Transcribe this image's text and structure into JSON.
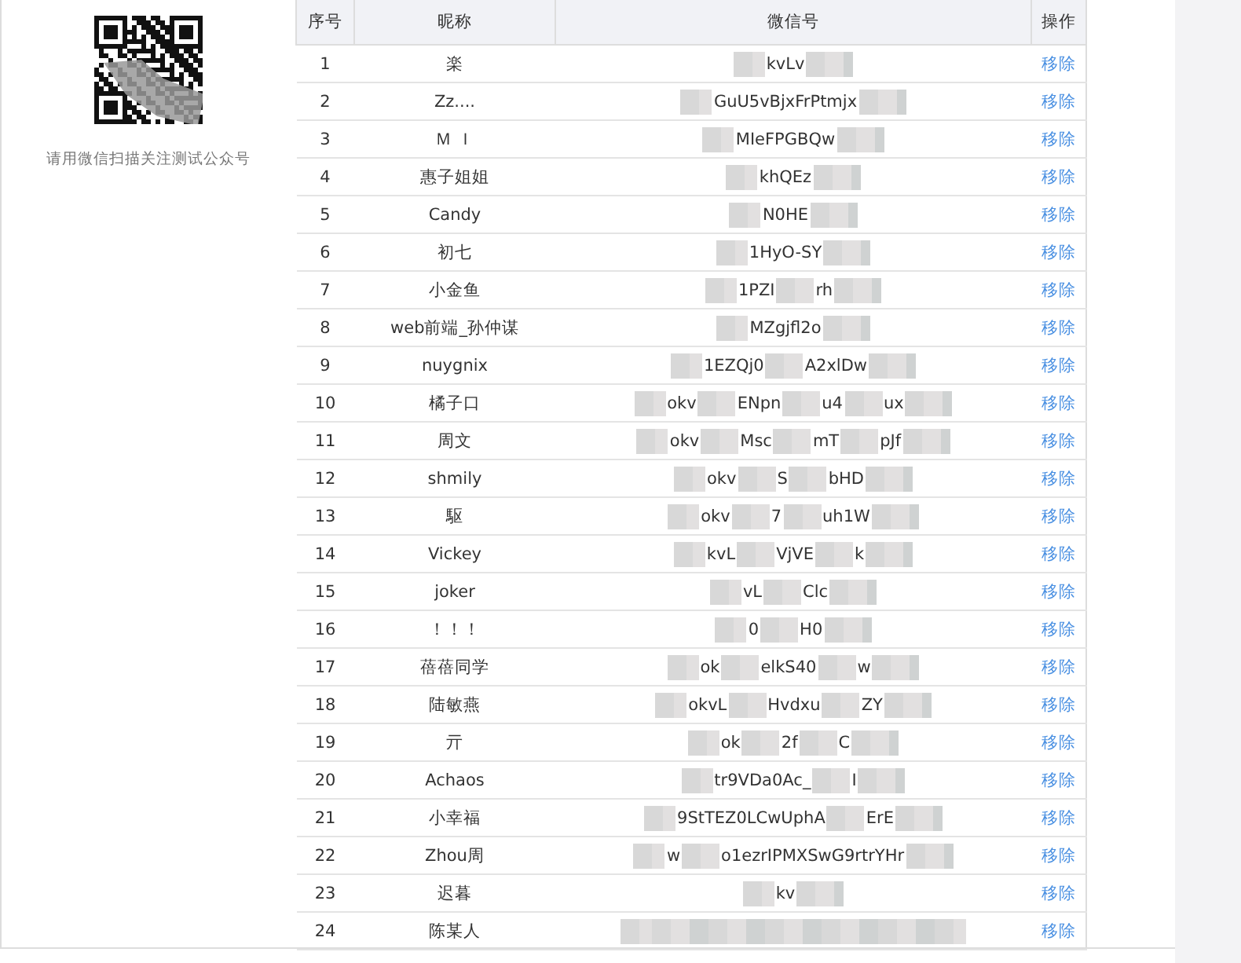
{
  "qr_panel": {
    "caption": "请用微信扫描关注测试公众号"
  },
  "table": {
    "columns": [
      "序号",
      "昵称",
      "微信号",
      "操作"
    ],
    "rows": [
      {
        "index": "1",
        "nickname": "楽",
        "wechat": [
          "kvLv"
        ],
        "action": "移除"
      },
      {
        "index": "2",
        "nickname": "Zz....",
        "wechat": [
          "GuU5vBjxFrPtmjx"
        ],
        "action": "移除"
      },
      {
        "index": "3",
        "nickname": "Ｍ Ｉ",
        "wechat": [
          "MIeFPGBQw"
        ],
        "action": "移除"
      },
      {
        "index": "4",
        "nickname": "惠子姐姐",
        "wechat": [
          "khQEz"
        ],
        "action": "移除"
      },
      {
        "index": "5",
        "nickname": "Candy",
        "wechat": [
          "N0HE"
        ],
        "action": "移除"
      },
      {
        "index": "6",
        "nickname": "初七",
        "wechat": [
          "1HyO-SY"
        ],
        "action": "移除"
      },
      {
        "index": "7",
        "nickname": "小金鱼",
        "wechat": [
          "1PZI",
          "rh"
        ],
        "action": "移除"
      },
      {
        "index": "8",
        "nickname": "web前端_孙仲谋",
        "wechat": [
          "MZgjfl2o"
        ],
        "action": "移除"
      },
      {
        "index": "9",
        "nickname": "nuygnix",
        "wechat": [
          "1EZQj0",
          "A2xlDw"
        ],
        "action": "移除"
      },
      {
        "index": "10",
        "nickname": "橘子口",
        "wechat": [
          "okv",
          "ENpn",
          "u4",
          "ux"
        ],
        "action": "移除"
      },
      {
        "index": "11",
        "nickname": "周文",
        "wechat": [
          "okv",
          "Msc",
          "mT",
          "pJf"
        ],
        "action": "移除"
      },
      {
        "index": "12",
        "nickname": "shmily",
        "wechat": [
          "okv",
          "S",
          "bHD"
        ],
        "action": "移除"
      },
      {
        "index": "13",
        "nickname": "駆",
        "wechat": [
          "okv",
          "7",
          "uh1W"
        ],
        "action": "移除"
      },
      {
        "index": "14",
        "nickname": "Vickey",
        "wechat": [
          "kvL",
          "VjVE",
          "k"
        ],
        "action": "移除"
      },
      {
        "index": "15",
        "nickname": "joker",
        "wechat": [
          "vL",
          "Clc"
        ],
        "action": "移除"
      },
      {
        "index": "16",
        "nickname": "！！！",
        "wechat": [
          "0",
          "H0"
        ],
        "action": "移除"
      },
      {
        "index": "17",
        "nickname": "蓓蓓同学",
        "wechat": [
          "ok",
          "elkS40",
          "w"
        ],
        "action": "移除"
      },
      {
        "index": "18",
        "nickname": "陆敏燕",
        "wechat": [
          "okvL",
          "Hvdxu",
          "ZY"
        ],
        "action": "移除"
      },
      {
        "index": "19",
        "nickname": "亓",
        "wechat": [
          "ok",
          "2f",
          "C"
        ],
        "action": "移除"
      },
      {
        "index": "20",
        "nickname": "Achaos",
        "wechat": [
          "tr9VDa0Ac_",
          "I"
        ],
        "action": "移除"
      },
      {
        "index": "21",
        "nickname": "小幸福",
        "wechat": [
          "9StTEZ0LCwUphA",
          "ErE"
        ],
        "action": "移除"
      },
      {
        "index": "22",
        "nickname": "Zhou周",
        "wechat": [
          "w",
          "o1ezrIPMXSwG9rtrYHr"
        ],
        "action": "移除"
      },
      {
        "index": "23",
        "nickname": "迟暮",
        "wechat": [
          "kv"
        ],
        "action": "移除"
      },
      {
        "index": "24",
        "nickname": "陈某人",
        "action": "移除"
      }
    ]
  }
}
